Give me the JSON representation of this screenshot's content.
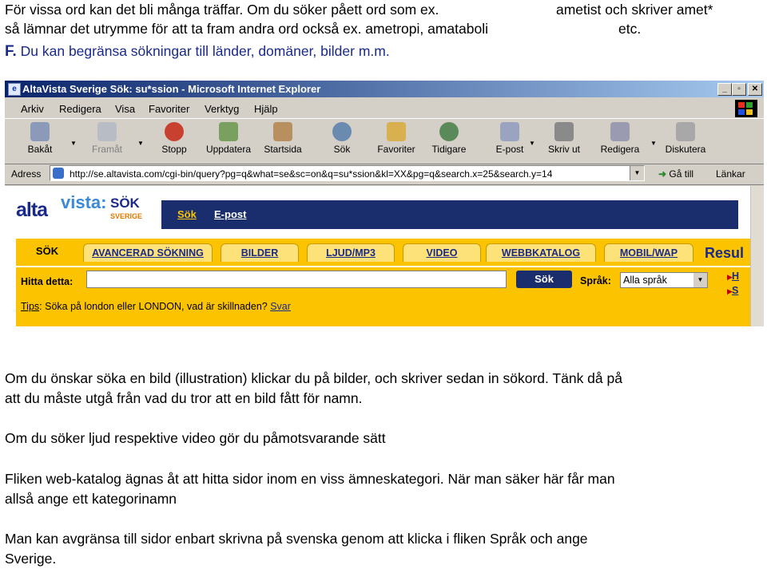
{
  "intro": {
    "line1a": "För vissa ord kan det bli många träffar. Om du söker påett ord som ex.",
    "line1b": "ametist och skriver amet*",
    "line2a": "så lämnar det utrymme för att ta fram andra ord också ex. ametropi, amataboli",
    "line2b": "etc.",
    "line3_prefix": "F.",
    "line3": " Du kan begränsa sökningar till länder, domäner, bilder m.m."
  },
  "browser": {
    "title": "AltaVista Sverige Sök: su*ssion - Microsoft Internet Explorer",
    "window_buttons": [
      "_",
      "▫",
      "✕"
    ],
    "menu": [
      "Arkiv",
      "Redigera",
      "Visa",
      "Favoriter",
      "Verktyg",
      "Hjälp"
    ],
    "toolbar": [
      "Bakåt",
      "Framåt",
      "Stopp",
      "Uppdatera",
      "Startsida",
      "Sök",
      "Favoriter",
      "Tidigare",
      "E-post",
      "Skriv ut",
      "Redigera",
      "Diskutera"
    ],
    "address_label": "Adress",
    "address_url": "http://se.altavista.com/cgi-bin/query?pg=q&what=se&sc=on&q=su*ssion&kl=XX&pg=q&search.x=25&search.y=14",
    "go_label": "Gå till",
    "links_label": "Länkar",
    "colors": {
      "titlebar": "#0a246a",
      "chrome": "#d4d0c8"
    }
  },
  "site": {
    "logo_alta": "alta",
    "logo_vista": "vista:",
    "logo_sok": "SÖK",
    "logo_sverige": "SVERIGE",
    "topnav": [
      "Sök",
      "E-post"
    ],
    "active_tab": "SÖK",
    "tabs": [
      "AVANCERAD SÖKNING",
      "BILDER",
      "LJUD/MP3",
      "VIDEO",
      "WEBBKATALOG",
      "MOBIL/WAP"
    ],
    "resul": "Resul",
    "hitta_label": "Hitta detta:",
    "search_button": "Sök",
    "language_label": "Språk:",
    "language_value": "Alla språk",
    "side_links": [
      "H",
      "S"
    ],
    "tips_label": "Tips",
    "tips_text": ": Söka på london eller LONDON, vad är skillnaden?",
    "tips_link": "Svar",
    "colors": {
      "navy": "#1a2e6e",
      "yellow": "#fcc400"
    }
  },
  "body": {
    "p1a": "Om du önskar söka en bild (illustration) klickar du på bilder, och skriver sedan in sökord.  Tänk då på",
    "p1b": "att du måste utgå från vad du tror att en bild fått för namn.",
    "p2": "Om du söker ljud respektive video gör du påmotsvarande sätt",
    "p3a": "Fliken web-katalog ägnas åt att hitta sidor inom en viss ämneskategori. När man säker här får man",
    "p3b": "allså ange ett kategorinamn",
    "p4a": "Man kan avgränsa till sidor enbart skrivna på svenska genom att klicka i fliken Språk och ange",
    "p4b": "Sverige."
  }
}
